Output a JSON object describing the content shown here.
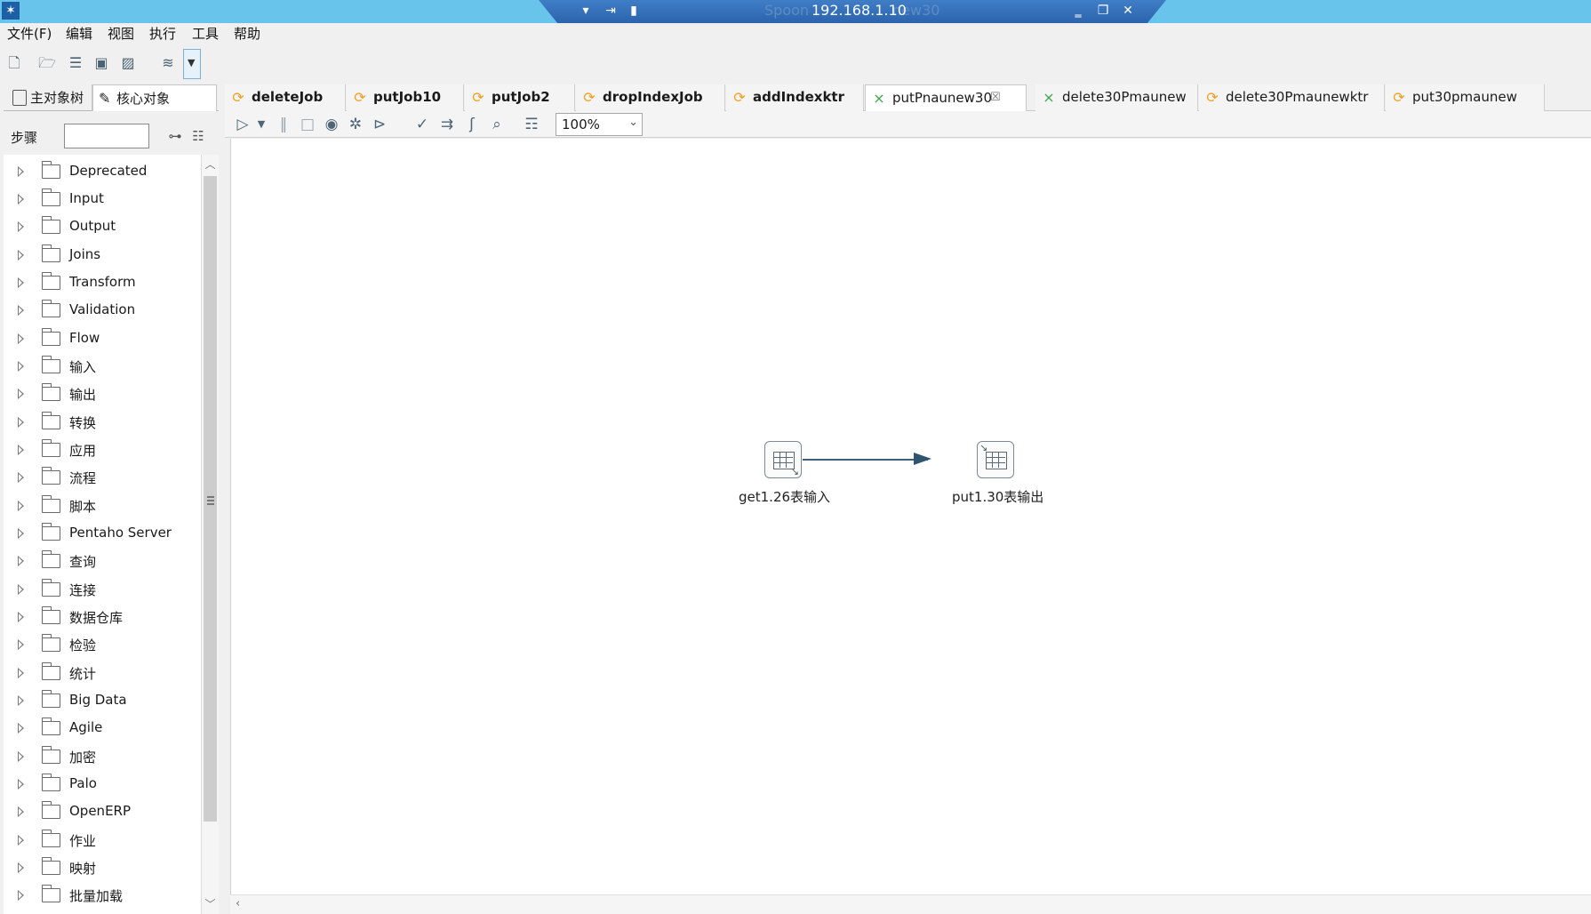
{
  "window": {
    "app_icon": "pentaho-spoon-icon",
    "rdp_host": "192.168.1.10",
    "rdp_title_partial_left": "Spoon",
    "rdp_title_partial_right": "new30",
    "icons": [
      "chevron-down-icon",
      "pin-icon",
      "signal-icon",
      "minimize-icon",
      "restore-icon",
      "close-icon"
    ]
  },
  "menu": {
    "items": [
      "文件(F)",
      "编辑",
      "视图",
      "执行",
      "工具",
      "帮助"
    ]
  },
  "main_toolbar": {
    "icons": [
      "new-file-icon",
      "open-folder-icon",
      "explore-repository-icon",
      "save-icon",
      "save-as-icon",
      "perspective-layers-icon",
      "dropdown-arrow-icon"
    ]
  },
  "left_panel": {
    "tabs": [
      "主对象树",
      "核心对象"
    ],
    "search_label": "步骤",
    "search_value": "",
    "tree_items": [
      "Deprecated",
      "Input",
      "Output",
      "Joins",
      "Transform",
      "Validation",
      "Flow",
      "输入",
      "输出",
      "转换",
      "应用",
      "流程",
      "脚本",
      "Pentaho Server",
      "查询",
      "连接",
      "数据仓库",
      "检验",
      "统计",
      "Big Data",
      "Agile",
      "加密",
      "Palo",
      "OpenERP",
      "作业",
      "映射",
      "批量加载"
    ]
  },
  "doc_tabs": [
    {
      "label": "deleteJob",
      "type": "job",
      "bold": true
    },
    {
      "label": "putJob10",
      "type": "job",
      "bold": true
    },
    {
      "label": "putJob2",
      "type": "job",
      "bold": true
    },
    {
      "label": "dropIndexJob",
      "type": "job",
      "bold": true
    },
    {
      "label": "addIndexktr",
      "type": "job",
      "bold": true
    },
    {
      "label": "putPnaunew30",
      "type": "transformation",
      "bold": false,
      "active": true
    },
    {
      "label": "delete30Pmaunew",
      "type": "transformation",
      "bold": false
    },
    {
      "label": "delete30Pmaunewktr",
      "type": "job",
      "bold": false
    },
    {
      "label": "put30pmaunew",
      "type": "job",
      "bold": false
    }
  ],
  "editor_toolbar": {
    "icons": [
      "run-icon",
      "run-options-dropdown-icon",
      "pause-icon",
      "stop-icon",
      "preview-icon",
      "debug-icon",
      "replay-icon",
      "verify-icon",
      "impact-icon",
      "sql-icon",
      "explore-db-icon",
      "show-results-icon"
    ],
    "zoom": "100%"
  },
  "canvas": {
    "steps": [
      {
        "name": "get1.26表输入",
        "kind": "table-input"
      },
      {
        "name": "put1.30表输出",
        "kind": "table-output"
      }
    ],
    "hops": [
      {
        "from": "get1.26表输入",
        "to": "put1.30表输出"
      }
    ]
  }
}
